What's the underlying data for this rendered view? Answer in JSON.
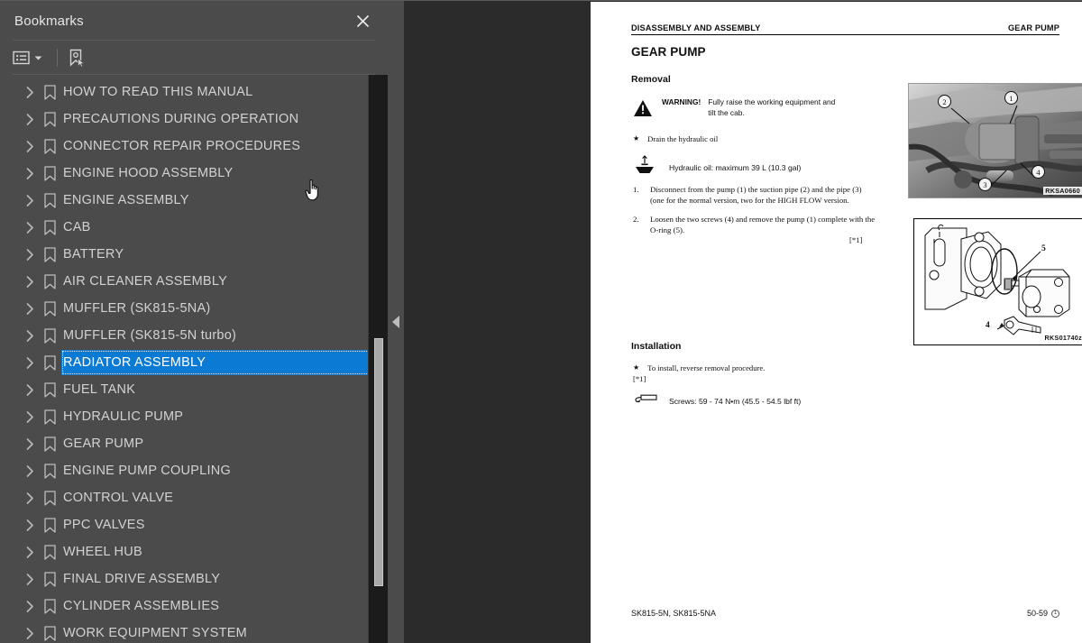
{
  "bookmarks_panel": {
    "title": "Bookmarks",
    "close_icon": "close-icon",
    "toolbar": {
      "options_label": "bookmark-options-icon",
      "options_caret": "chevron-down-icon",
      "new_bookmark_label": "new-bookmark-icon"
    },
    "selected_item": "RADIATOR ASSEMBLY",
    "selection_color": "#0b7ad4",
    "items": [
      {
        "label": "HOW TO READ THIS MANUAL",
        "selected": false
      },
      {
        "label": "PRECAUTIONS DURING OPERATION",
        "selected": false
      },
      {
        "label": "CONNECTOR REPAIR PROCEDURES",
        "selected": false
      },
      {
        "label": "ENGINE HOOD ASSEMBLY",
        "selected": false
      },
      {
        "label": "ENGINE ASSEMBLY",
        "selected": false
      },
      {
        "label": "CAB",
        "selected": false
      },
      {
        "label": "BATTERY",
        "selected": false
      },
      {
        "label": "AIR CLEANER ASSEMBLY",
        "selected": false
      },
      {
        "label": "MUFFLER (SK815-5NA)",
        "selected": false
      },
      {
        "label": "MUFFLER (SK815-5N turbo)",
        "selected": false
      },
      {
        "label": "RADIATOR ASSEMBLY",
        "selected": true
      },
      {
        "label": "FUEL TANK",
        "selected": false
      },
      {
        "label": "HYDRAULIC PUMP",
        "selected": false
      },
      {
        "label": "GEAR PUMP",
        "selected": false
      },
      {
        "label": "ENGINE PUMP COUPLING",
        "selected": false
      },
      {
        "label": "CONTROL VALVE",
        "selected": false
      },
      {
        "label": "PPC VALVES",
        "selected": false
      },
      {
        "label": "WHEEL HUB",
        "selected": false
      },
      {
        "label": "FINAL DRIVE ASSEMBLY",
        "selected": false
      },
      {
        "label": "CYLINDER ASSEMBLIES",
        "selected": false
      },
      {
        "label": "WORK EQUIPMENT SYSTEM",
        "selected": false
      }
    ]
  },
  "splitter": {
    "collapse_icon": "collapse-left-arrow-icon"
  },
  "document": {
    "running_head_left": "DISASSEMBLY AND ASSEMBLY",
    "running_head_right": "GEAR PUMP",
    "title": "GEAR PUMP",
    "sections": {
      "removal": "Removal",
      "installation": "Installation"
    },
    "warning": {
      "icon": "warning-triangle-icon",
      "word": "WARNING!",
      "text": "Fully raise the working equipment and tilt the cab."
    },
    "drain_note": {
      "bullet": "★",
      "text": "Drain the hydraulic oil"
    },
    "oil_spec": {
      "icon": "oil-capacity-icon",
      "text": "Hydraulic oil: maximum 39 L (10.3 gal)"
    },
    "steps": [
      {
        "number": "1.",
        "text": "Disconnect from the pump (1) the suction pipe (2) and the pipe (3) (one for the normal version, two for the HIGH FLOW version."
      },
      {
        "number": "2.",
        "text": "Loosen the two screws (4) and remove the pump (1) complete with the O-ring (5)."
      }
    ],
    "ref_mark_step": "[*1]",
    "install_note": {
      "bullet": "★",
      "text": "To install, reverse removal procedure."
    },
    "ref_mark_install": "[*1]",
    "screws_spec": {
      "icon": "torque-wrench-icon",
      "text": "Screws: 59 - 74 N•m (45.5 - 54.5 lbf ft)"
    },
    "figures": [
      {
        "name": "gear-pump-photo",
        "code": "RKSA0660",
        "callouts": [
          "1",
          "2",
          "3",
          "4"
        ]
      },
      {
        "name": "gear-pump-exploded-drawing",
        "code": "RKS01740z",
        "callouts": [
          "4",
          "5"
        ]
      }
    ],
    "footer": {
      "models": "SK815-5N, SK815-5NA",
      "page_number": "50-59",
      "page_mark": "1"
    }
  },
  "cursor": {
    "type": "pointing-hand-cursor"
  }
}
